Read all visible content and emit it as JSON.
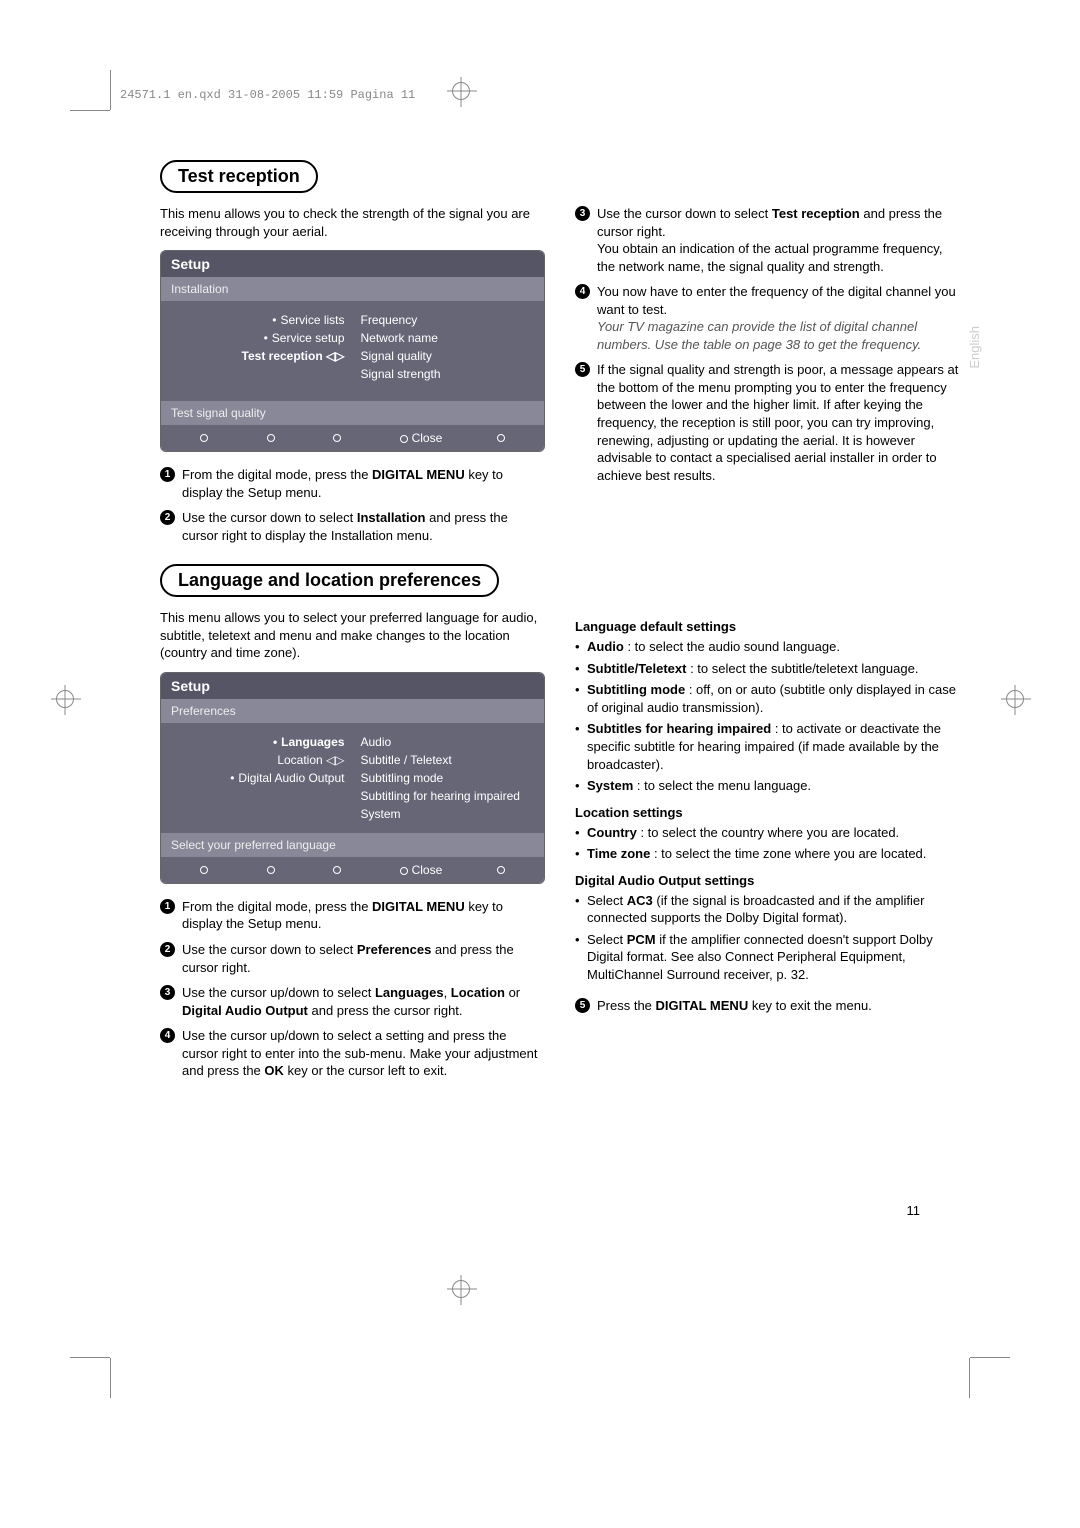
{
  "crop_header": "24571.1 en.qxd  31-08-2005  11:59  Pagina 11",
  "side_tab": "English",
  "page_number": "11",
  "section1": {
    "title": "Test reception",
    "intro": "This menu allows you to check the strength of the signal you are receiving through your aerial.",
    "osd": {
      "setup": "Setup",
      "sub": "Installation",
      "left": [
        "Service lists",
        "Service setup",
        "Test reception"
      ],
      "right": [
        "Frequency",
        "Network name",
        "Signal quality",
        "Signal strength"
      ],
      "hint": "Test signal quality",
      "close": "Close"
    },
    "left_steps": [
      {
        "n": "1",
        "before": "From the digital mode, press the ",
        "bold1": "DIGITAL MENU",
        "after1": " key to display the Setup menu."
      },
      {
        "n": "2",
        "before": "Use the cursor down to select ",
        "bold1": "Installation",
        "after1": " and press the cursor right to display the Installation menu."
      }
    ],
    "right_steps": [
      {
        "n": "3",
        "before": "Use the cursor down to select ",
        "bold1": "Test reception",
        "after1": " and press the cursor right.",
        "after2": "You obtain an indication of the actual programme frequency, the network name, the signal quality and strength."
      },
      {
        "n": "4",
        "before": "You now have to enter the frequency of the digital channel you want to test.",
        "italic": "Your TV magazine can provide the list of digital channel numbers. Use the table on page 38 to get the frequency."
      },
      {
        "n": "5",
        "text": "If the signal quality and strength is poor, a message appears at the bottom of the menu prompting you to enter the frequency between the lower and the higher limit. If after keying the frequency, the reception is still poor, you can try improving, renewing, adjusting or updating the aerial. It is however advisable to contact a specialised aerial installer in order to achieve best results."
      }
    ]
  },
  "section2": {
    "title": "Language and location preferences",
    "intro": "This menu allows you to select your preferred language for audio, subtitle, teletext and menu and make changes to the location (country and time zone).",
    "osd": {
      "setup": "Setup",
      "sub": "Preferences",
      "left": [
        "Languages",
        "Location",
        "Digital Audio Output"
      ],
      "right": [
        "Audio",
        "Subtitle / Teletext",
        "Subtitling mode",
        "Subtitling for hearing impaired",
        "System"
      ],
      "hint": "Select your preferred language",
      "close": "Close"
    },
    "left_steps": [
      {
        "n": "1",
        "before": "From the digital mode, press the ",
        "bold1": "DIGITAL MENU",
        "after1": " key to display the Setup menu."
      },
      {
        "n": "2",
        "before": "Use the cursor down to select ",
        "bold1": "Preferences",
        "after1": " and press the cursor right."
      },
      {
        "n": "3",
        "before": "Use the cursor up/down to select ",
        "bold1": "Languages",
        "mid": ", ",
        "bold2": "Location",
        "mid2": " or ",
        "bold3": "Digital Audio Output",
        "after1": " and press the cursor right."
      },
      {
        "n": "4",
        "before": "Use the cursor up/down to select a setting and press the cursor right to enter into the sub-menu. Make your adjustment and press the ",
        "bold1": "OK",
        "after1": " key or the cursor left to exit."
      }
    ],
    "right": {
      "h1": "Language default settings",
      "lang": [
        {
          "b": "Audio",
          "t": " : to select the audio sound language."
        },
        {
          "b": "Subtitle/Teletext",
          "t": " : to select the subtitle/teletext language."
        },
        {
          "b": "Subtitling mode",
          "t": " : off, on or auto (subtitle only displayed in case of original audio transmission)."
        },
        {
          "b": "Subtitles for hearing impaired",
          "t": " : to activate or deactivate the specific subtitle for hearing impaired (if made available by the broadcaster)."
        },
        {
          "b": "System",
          "t": " : to select the menu language."
        }
      ],
      "h2": "Location settings",
      "loc": [
        {
          "b": "Country",
          "t": " : to select the country where you are located."
        },
        {
          "b": "Time zone",
          "t": " : to select the time zone where you are located."
        }
      ],
      "h3": "Digital Audio Output settings",
      "dao": [
        {
          "pre": "Select ",
          "b": "AC3",
          "t": " (if the signal is broadcasted and if the amplifier connected supports the Dolby Digital format)."
        },
        {
          "pre": "Select ",
          "b": "PCM",
          "t": " if the amplifier connected doesn't support Dolby Digital format. See also Connect Peripheral Equipment, MultiChannel Surround receiver, p. 32."
        }
      ],
      "step5": {
        "n": "5",
        "before": "Press the ",
        "bold1": "DIGITAL MENU",
        "after1": " key to exit the menu."
      }
    }
  }
}
